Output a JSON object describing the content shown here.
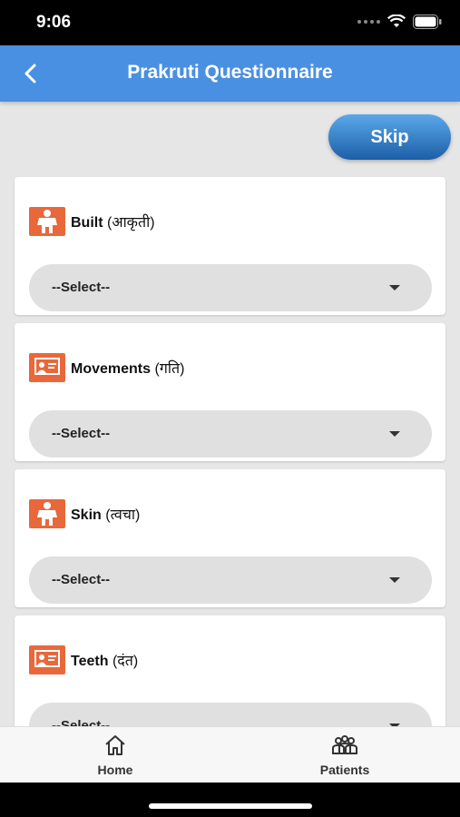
{
  "status_bar": {
    "time": "9:06"
  },
  "header": {
    "title": "Prakruti Questionnaire"
  },
  "skip_label": "Skip",
  "questions": [
    {
      "label_en": "Built",
      "label_hi": "(आकृती)",
      "selected": "--Select--",
      "icon": "body-figure-icon"
    },
    {
      "label_en": "Movements",
      "label_hi": "(गति)",
      "selected": "--Select--",
      "icon": "presentation-board-icon"
    },
    {
      "label_en": "Skin",
      "label_hi": "(त्वचा)",
      "selected": "--Select--",
      "icon": "body-figure-icon"
    },
    {
      "label_en": "Teeth",
      "label_hi": "(दंत)",
      "selected": "--Select--",
      "icon": "presentation-board-icon"
    }
  ],
  "bottom_nav": {
    "home_label": "Home",
    "patients_label": "Patients"
  },
  "colors": {
    "app_bar": "#4a90e2",
    "icon_bg": "#e8683c",
    "skip_gradient_top": "#5aa8e8",
    "skip_gradient_bottom": "#1d5fa8"
  }
}
